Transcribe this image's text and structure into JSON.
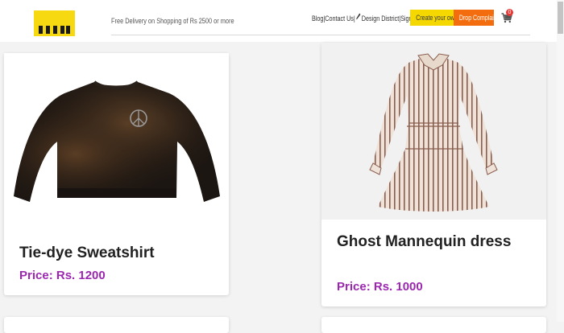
{
  "header": {
    "logo_name": "logo",
    "promo_text": "Free Delivery on Shopping of Rs 2500 or more",
    "nav": {
      "blog": "Blog",
      "sep1": "|",
      "contact": "Contact Us",
      "sep2": "|",
      "design": "Design District",
      "sep3": "|",
      "signup": "Signup",
      "sep4": "|"
    },
    "create_button": "Create your own",
    "complaint_button": "Drop Complaint",
    "cart_count": "0",
    "colors": {
      "yellow": "#f5d800",
      "orange": "#f36d0f",
      "badge": "#e53935"
    },
    "icons": [
      "pencil-icon",
      "cart-icon"
    ]
  },
  "products": [
    {
      "title": "Tie-dye Sweatshirt",
      "price_label": "Price: Rs. ",
      "price_value": "1200",
      "image": "sweatshirt-image"
    },
    {
      "title": "Ghost Mannequin dress",
      "price_label": "Price: Rs. ",
      "price_value": "1000",
      "image": "dress-image"
    }
  ],
  "accent_color": "#9c27b0"
}
